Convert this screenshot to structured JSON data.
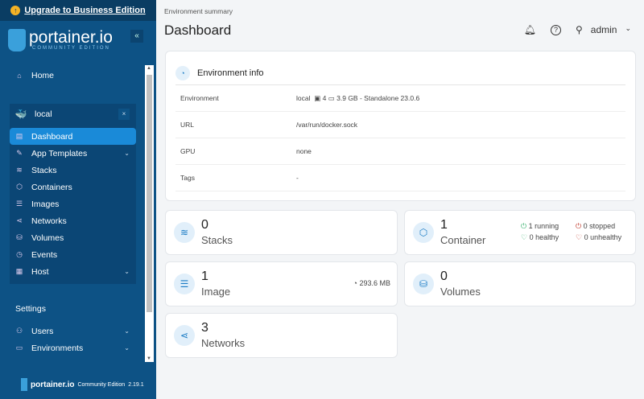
{
  "banner": {
    "label": "Upgrade to Business Edition"
  },
  "logo": {
    "text": "portainer.io",
    "sub": "COMMUNITY EDITION"
  },
  "sidebar": {
    "home": "Home",
    "environment": "local",
    "items": [
      {
        "label": "Dashboard",
        "icon": "dashboard-icon"
      },
      {
        "label": "App Templates",
        "icon": "edit-icon",
        "chevron": true
      },
      {
        "label": "Stacks",
        "icon": "layers-icon"
      },
      {
        "label": "Containers",
        "icon": "box-icon"
      },
      {
        "label": "Images",
        "icon": "list-icon"
      },
      {
        "label": "Networks",
        "icon": "share-icon"
      },
      {
        "label": "Volumes",
        "icon": "database-icon"
      },
      {
        "label": "Events",
        "icon": "history-icon"
      },
      {
        "label": "Host",
        "icon": "server-icon",
        "chevron": true
      }
    ],
    "settings_title": "Settings",
    "settings": [
      {
        "label": "Users"
      },
      {
        "label": "Environments"
      }
    ],
    "footer": {
      "brand": "portainer.io",
      "edition": "Community Edition",
      "version": "2.19.1"
    }
  },
  "header": {
    "breadcrumb": "Environment summary",
    "title": "Dashboard",
    "user": "admin"
  },
  "env_info": {
    "title": "Environment info",
    "rows": [
      {
        "key": "Environment",
        "value": "local",
        "cpu": "4",
        "mem": "3.9 GB",
        "suffix": "- Standalone 23.0.6"
      },
      {
        "key": "URL",
        "value": "/var/run/docker.sock"
      },
      {
        "key": "GPU",
        "value": "none"
      },
      {
        "key": "Tags",
        "value": "-"
      }
    ]
  },
  "stats": {
    "stacks": {
      "count": "0",
      "label": "Stacks"
    },
    "containers": {
      "count": "1",
      "label": "Container",
      "running": "1 running",
      "stopped": "0 stopped",
      "healthy": "0 healthy",
      "unhealthy": "0 unhealthy"
    },
    "images": {
      "count": "1",
      "label": "Image",
      "size": "293.6 MB"
    },
    "volumes": {
      "count": "0",
      "label": "Volumes"
    },
    "networks": {
      "count": "3",
      "label": "Networks"
    }
  },
  "colors": {
    "sidebar": "#0d5285",
    "accent": "#1a8ad8",
    "running": "#3cb371",
    "stopped": "#c0392b"
  }
}
